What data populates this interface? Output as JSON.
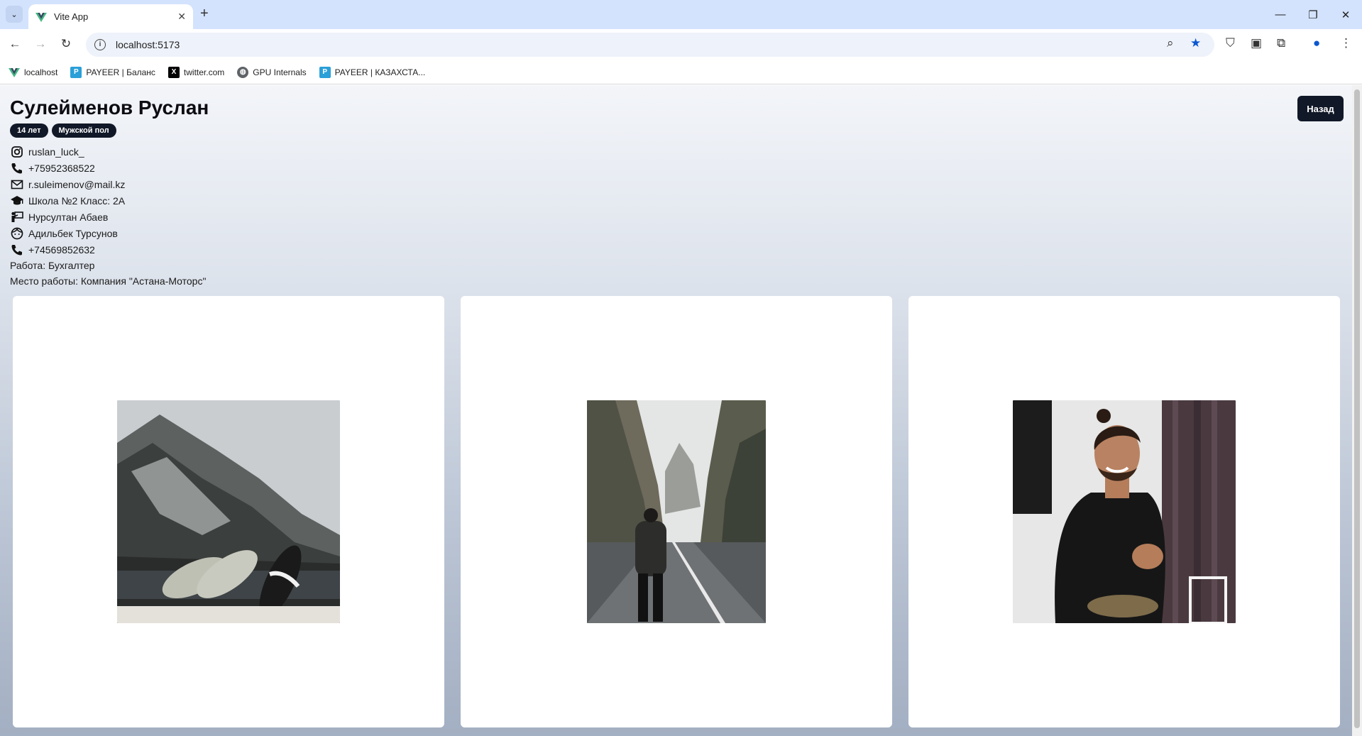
{
  "browser": {
    "tab_title": "Vite App",
    "url": "localhost:5173",
    "bookmarks": [
      {
        "label": "localhost",
        "icon": "vue-icon",
        "color": "#41b883"
      },
      {
        "label": "PAYEER | Баланс",
        "icon": "payeer-icon",
        "color": "#2a9fd8"
      },
      {
        "label": "twitter.com",
        "icon": "x-icon",
        "color": "#000000"
      },
      {
        "label": "GPU Internals",
        "icon": "globe-icon",
        "color": "#5f6368"
      },
      {
        "label": "PAYEER | КАЗАХСТА...",
        "icon": "payeer-icon",
        "color": "#2a9fd8"
      }
    ]
  },
  "profile": {
    "name": "Сулейменов Руслан",
    "age_badge": "14 лет",
    "gender_badge": "Мужской пол",
    "back_label": "Назад",
    "instagram": "ruslan_luck_",
    "phone": "+75952368522",
    "email": "r.suleimenov@mail.kz",
    "school": "Школа №2 Класс: 2А",
    "teacher": "Нурсултан Абаев",
    "parent": "Адильбек Турсунов",
    "parent_phone": "+74569852632",
    "job": "Работа: Бухгалтер",
    "workplace": "Место работы: Компания \"Астана-Моторс\""
  },
  "photos": [
    {
      "subject": "mountain-lake-sneakers-photo"
    },
    {
      "subject": "canyon-road-walker-photo"
    },
    {
      "subject": "smiling-man-portrait-photo"
    }
  ]
}
